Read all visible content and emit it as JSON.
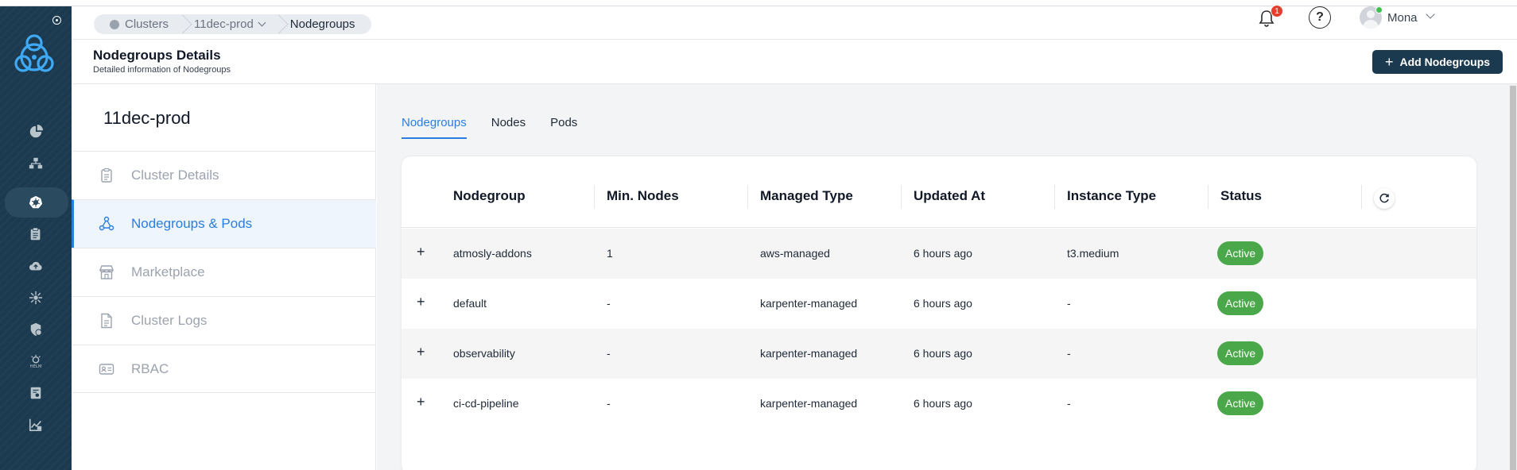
{
  "breadcrumbs": [
    {
      "label": "Clusters"
    },
    {
      "label": "11dec-prod"
    },
    {
      "label": "Nodegroups"
    }
  ],
  "notifications": {
    "count": "1"
  },
  "help": {
    "label": "?"
  },
  "user": {
    "name": "Mona"
  },
  "page": {
    "title": "Nodegroups Details",
    "subtitle": "Detailed information of Nodegroups",
    "add_button": "Add Nodegroups"
  },
  "sidebar": {
    "cluster_name": "11dec-prod",
    "items": [
      {
        "label": "Cluster Details",
        "icon": "clipboard-icon"
      },
      {
        "label": "Nodegroups & Pods",
        "icon": "nodes-icon"
      },
      {
        "label": "Marketplace",
        "icon": "store-icon"
      },
      {
        "label": "Cluster Logs",
        "icon": "document-icon"
      },
      {
        "label": "RBAC",
        "icon": "id-card-icon"
      }
    ]
  },
  "tabs": [
    {
      "label": "Nodegroups"
    },
    {
      "label": "Nodes"
    },
    {
      "label": "Pods"
    }
  ],
  "table": {
    "columns": [
      "Nodegroup",
      "Min. Nodes",
      "Managed Type",
      "Updated At",
      "Instance Type",
      "Status"
    ],
    "rows": [
      {
        "expand": "+",
        "nodegroup": "atmosly-addons",
        "min_nodes": "1",
        "managed_type": "aws-managed",
        "updated_at": "6 hours ago",
        "instance_type": "t3.medium",
        "status": "Active"
      },
      {
        "expand": "+",
        "nodegroup": "default",
        "min_nodes": "-",
        "managed_type": "karpenter-managed",
        "updated_at": "6 hours ago",
        "instance_type": "-",
        "status": "Active"
      },
      {
        "expand": "+",
        "nodegroup": "observability",
        "min_nodes": "-",
        "managed_type": "karpenter-managed",
        "updated_at": "6 hours ago",
        "instance_type": "-",
        "status": "Active"
      },
      {
        "expand": "+",
        "nodegroup": "ci-cd-pipeline",
        "min_nodes": "-",
        "managed_type": "karpenter-managed",
        "updated_at": "6 hours ago",
        "instance_type": "-",
        "status": "Active"
      }
    ]
  },
  "colors": {
    "accent": "#2a7de1",
    "rail": "#1c3a4f",
    "status_active": "#4aa84a",
    "notification": "#e53e2f"
  }
}
